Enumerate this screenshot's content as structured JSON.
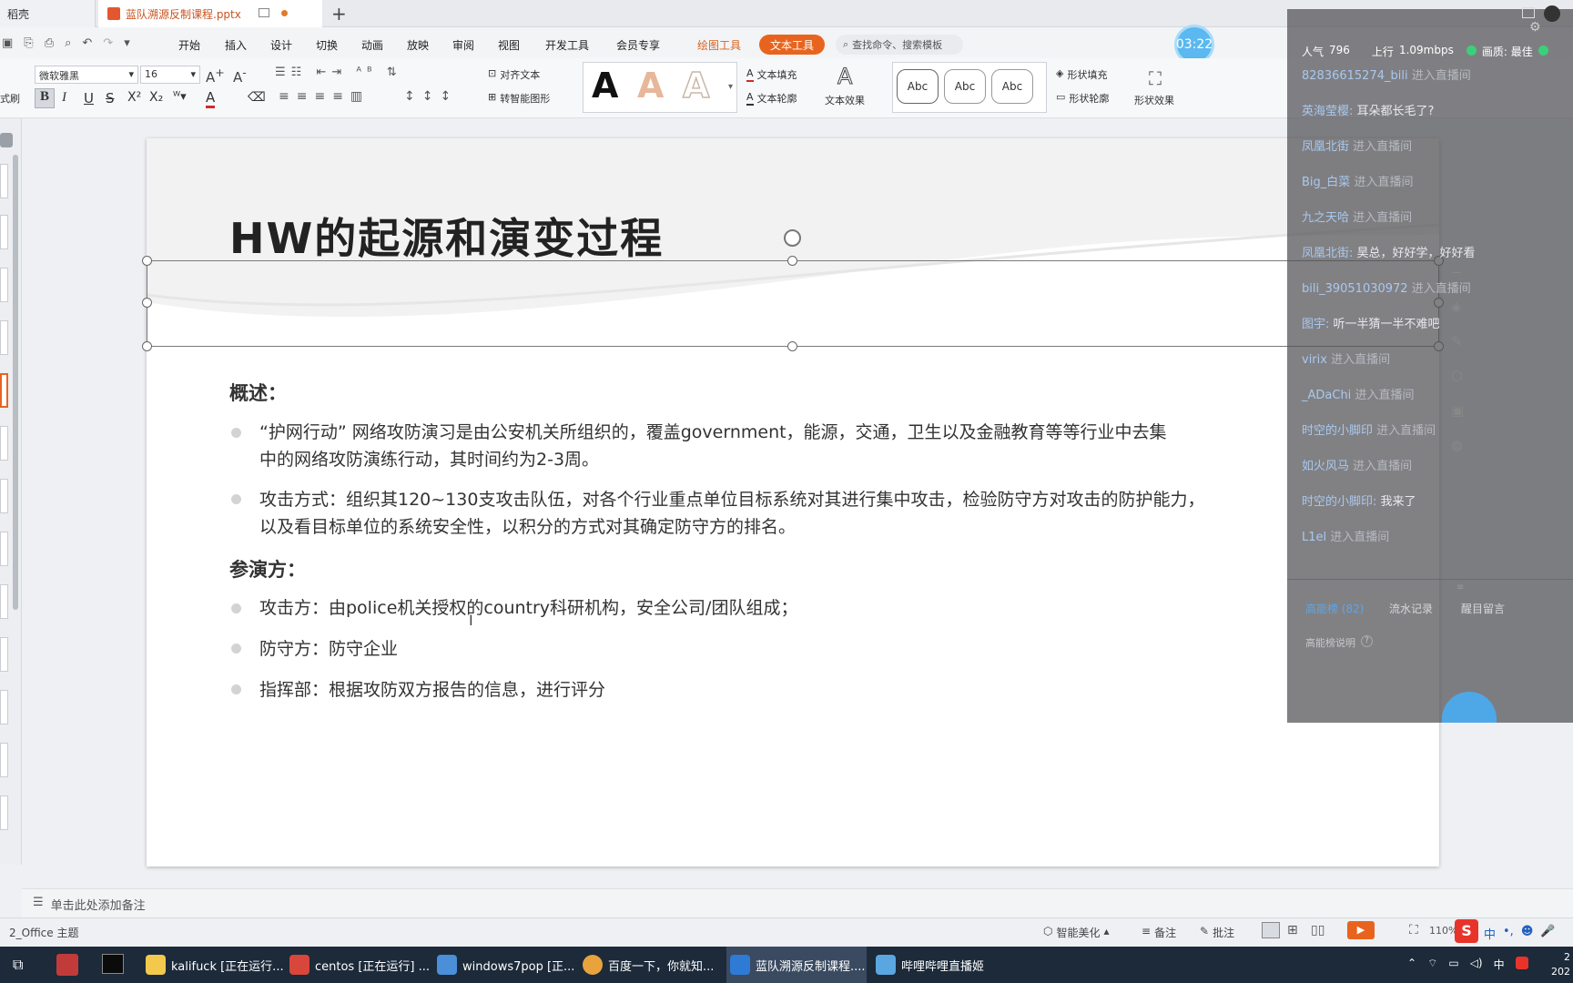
{
  "tabs": {
    "home": "稻壳",
    "file": "蓝队溯源反制课程.pptx"
  },
  "menu": [
    "开始",
    "插入",
    "设计",
    "切换",
    "动画",
    "放映",
    "审阅",
    "视图",
    "开发工具",
    "会员专享",
    "绘图工具",
    "文本工具"
  ],
  "search_placeholder": "查找命令、搜索模板",
  "timer": "03:22",
  "ribbon": {
    "font_name": "微软雅黑",
    "font_size": "16",
    "align_text": "对齐文本",
    "smart_shape": "转智能图形",
    "text_fill": "文本填充",
    "text_outline": "文本轮廓",
    "text_effect": "文本效果",
    "shape_fill": "形状填充",
    "shape_outline": "形状轮廓",
    "shape_effect": "形状效果",
    "abc": "Abc",
    "left_cut1": "式刷"
  },
  "slide": {
    "title": "HW的起源和演变过程",
    "overview_label": "概述：",
    "p1": "“护网行动” 网络攻防演习是由公安机关所组织的，覆盖government，能源，交通，卫生以及金融教育等等行业中去集",
    "p1b": "中的网络攻防演练行动，其时间约为2-3周。",
    "p2": "攻击方式：组织其120~130支攻击队伍，对各个行业重点单位目标系统对其进行集中攻击，检验防守方对攻击的防护能力，",
    "p2b": "以及看目标单位的系统安全性，以积分的方式对其确定防守方的排名。",
    "parties_label": "参演方：",
    "p3": "攻击方：由police机关授权的country科研机构，安全公司/团队组成；",
    "p4": "防守方：防守企业",
    "p5": "指挥部：根据攻防双方报告的信息，进行评分"
  },
  "live": {
    "popularity_label": "人气",
    "popularity": "796",
    "upload_label": "上行",
    "upload": "1.09mbps",
    "quality": "画质: 最佳",
    "chat": [
      {
        "user": "82836615274_bili",
        "msg": "进入直播间",
        "enter": true
      },
      {
        "user": "英海莹樱:",
        "msg": "耳朵都长毛了?",
        "enter": false
      },
      {
        "user": "凤凰北街",
        "msg": "进入直播间",
        "enter": true
      },
      {
        "user": "Big_白菜",
        "msg": "进入直播间",
        "enter": true
      },
      {
        "user": "九之天哈",
        "msg": "进入直播间",
        "enter": true
      },
      {
        "user": "凤凰北街:",
        "msg": "昊总，好好学，好好看",
        "enter": false
      },
      {
        "user": "bili_39051030972",
        "msg": "进入直播间",
        "enter": true
      },
      {
        "user": "图宇:",
        "msg": "听一半猜一半不难吧",
        "enter": false
      },
      {
        "user": "virix",
        "msg": "进入直播间",
        "enter": true
      },
      {
        "user": "_ADaChi",
        "msg": "进入直播间",
        "enter": true
      },
      {
        "user": "时空的小脚印",
        "msg": "进入直播间",
        "enter": true
      },
      {
        "user": "如火风马",
        "msg": "进入直播间",
        "enter": true
      },
      {
        "user": "时空的小脚印:",
        "msg": "我来了",
        "enter": false
      },
      {
        "user": "L1el",
        "msg": "进入直播间",
        "enter": true
      }
    ],
    "tabs": [
      "高能榜 (82)",
      "流水记录",
      "醒目留言"
    ],
    "help": "高能榜说明"
  },
  "notes_placeholder": "单击此处添加备注",
  "status": {
    "theme": "2_Office 主题",
    "beautify": "智能美化",
    "notes": "备注",
    "comments": "批注",
    "zoom": "110%"
  },
  "taskbar": [
    {
      "label": "kalifuck [正在运行...",
      "color": "#f2c94c"
    },
    {
      "label": "centos [正在运行] ...",
      "color": "#d9463b"
    },
    {
      "label": "windows7pop [正...",
      "color": "#4a8fd8"
    },
    {
      "label": "百度一下，你就知...",
      "color": "#e8a33d"
    },
    {
      "label": "蓝队溯源反制课程....",
      "color": "#2e7bd6"
    },
    {
      "label": "哔哩哔哩直播姬",
      "color": "#5aa6e0"
    }
  ],
  "tray": {
    "ime": "中",
    "time": "2",
    "date": "202"
  }
}
